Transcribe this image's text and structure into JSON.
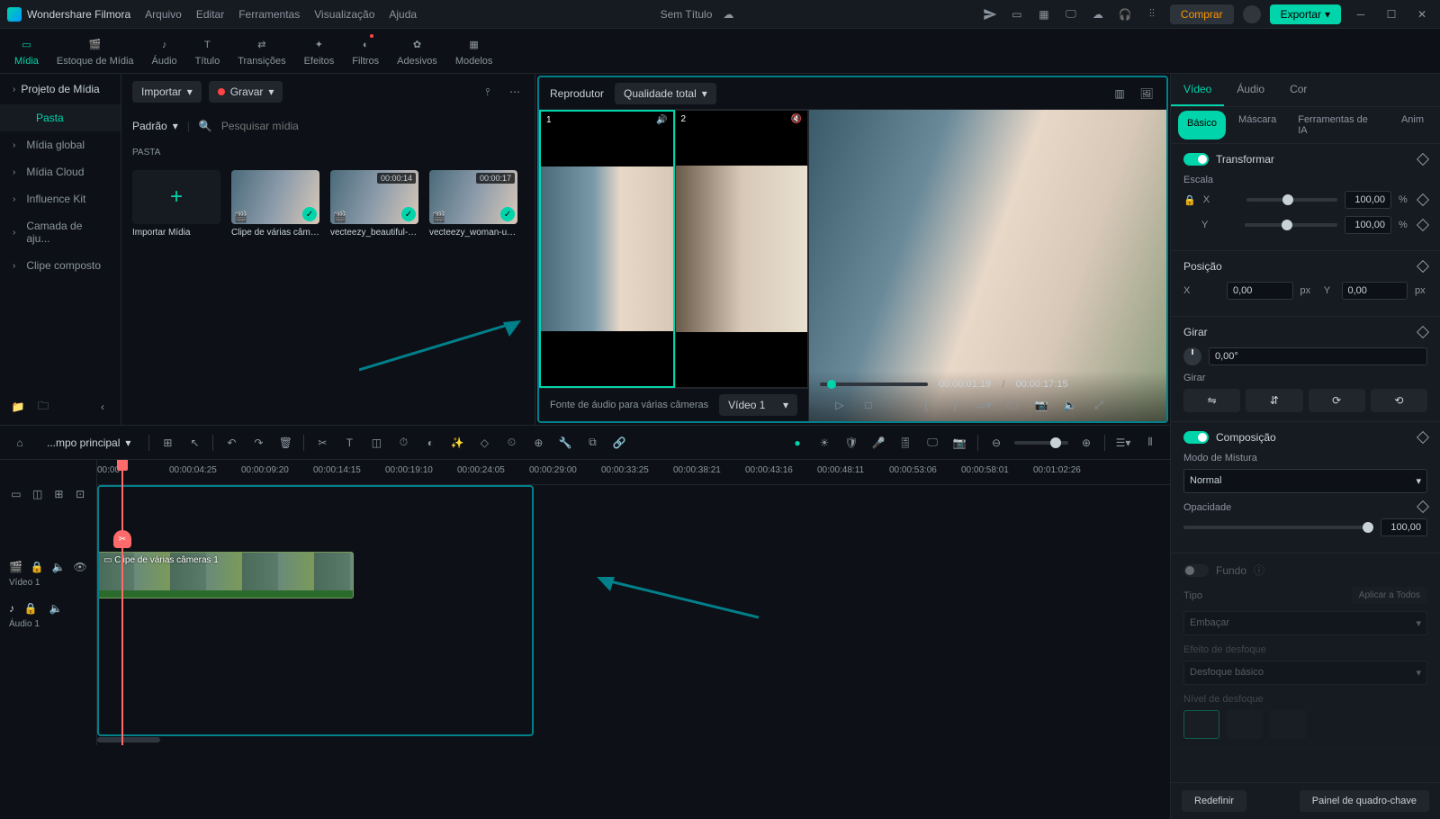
{
  "app": {
    "name": "Wondershare Filmora",
    "document": "Sem Título"
  },
  "menubar": [
    "Arquivo",
    "Editar",
    "Ferramentas",
    "Visualização",
    "Ajuda"
  ],
  "titlebar": {
    "buy": "Comprar",
    "export": "Exportar"
  },
  "mainTabs": [
    {
      "id": "midia",
      "label": "Mídia",
      "active": true
    },
    {
      "id": "estoque",
      "label": "Estoque de Mídia"
    },
    {
      "id": "audio",
      "label": "Áudio"
    },
    {
      "id": "titulo",
      "label": "Título"
    },
    {
      "id": "transicoes",
      "label": "Transições"
    },
    {
      "id": "efeitos",
      "label": "Efeitos"
    },
    {
      "id": "filtros",
      "label": "Filtros",
      "dot": true
    },
    {
      "id": "adesivos",
      "label": "Adesivos"
    },
    {
      "id": "modelos",
      "label": "Modelos"
    }
  ],
  "sidebar": {
    "header": "Projeto de Mídia",
    "items": [
      {
        "label": "Pasta",
        "active": true
      },
      {
        "label": "Mídia global"
      },
      {
        "label": "Mídia Cloud"
      },
      {
        "label": "Influence Kit"
      },
      {
        "label": "Camada de aju..."
      },
      {
        "label": "Clipe composto"
      }
    ]
  },
  "mediaPanel": {
    "import": "Importar",
    "record": "Gravar",
    "sortLabel": "Padrão",
    "searchPlaceholder": "Pesquisar mídia",
    "sectionLabel": "PASTA",
    "items": [
      {
        "name": "Importar Mídia",
        "import": true
      },
      {
        "name": "Clipe de várias câmeras...",
        "checked": true
      },
      {
        "name": "vecteezy_beautiful-asi...",
        "dur": "00:00:14",
        "checked": true
      },
      {
        "name": "vecteezy_woman-usin...",
        "dur": "00:00:17",
        "checked": true
      }
    ]
  },
  "preview": {
    "title": "Reprodutor",
    "quality": "Qualidade total",
    "audioSourceLabel": "Fonte de áudio para várias câmeras",
    "audioSource": "Vídeo 1",
    "currentTC": "00:00:01:19",
    "totalTC": "00:00:17:15"
  },
  "props": {
    "tabs": [
      "Vídeo",
      "Áudio",
      "Cor"
    ],
    "subtabs": [
      "Básico",
      "Máscara",
      "Ferramentas de IA",
      "Anim"
    ],
    "transform": {
      "title": "Transformar",
      "scaleLabel": "Escala",
      "x": "100,00",
      "y": "100,00",
      "unit": "%"
    },
    "position": {
      "title": "Posição",
      "x": "0,00",
      "xunit": "px",
      "y": "0,00",
      "yunit": "px"
    },
    "rotate": {
      "title": "Girar",
      "value": "0,00°",
      "flipTitle": "Girar"
    },
    "composite": {
      "title": "Composição",
      "blendLabel": "Modo de Mistura",
      "blend": "Normal",
      "opacityLabel": "Opacidade",
      "opacity": "100,00"
    },
    "background": {
      "title": "Fundo",
      "typeLabel": "Tipo",
      "applyAll": "Aplicar a Todos",
      "typeValue": "Embaçar",
      "blurEffectLabel": "Efeito de desfoque",
      "blurEffect": "Desfoque básico",
      "blurLevelLabel": "Nível de desfoque"
    },
    "footer": {
      "reset": "Redefinir",
      "keyframe": "Painel de quadro-chave"
    }
  },
  "timeline": {
    "breadcrumb": "...mpo principal",
    "ruler": [
      "00:00",
      "00:00:04:25",
      "00:00:09:20",
      "00:00:14:15",
      "00:00:19:10",
      "00:00:24:05",
      "00:00:29:00",
      "00:00:33:25",
      "00:00:38:21",
      "00:00:43:16",
      "00:00:48:11",
      "00:00:53:06",
      "00:00:58:01",
      "00:01:02:26"
    ],
    "tracks": {
      "video": "Vídeo 1",
      "audio": "Áudio 1"
    },
    "clipName": "Clipe de várias câmeras 1"
  }
}
